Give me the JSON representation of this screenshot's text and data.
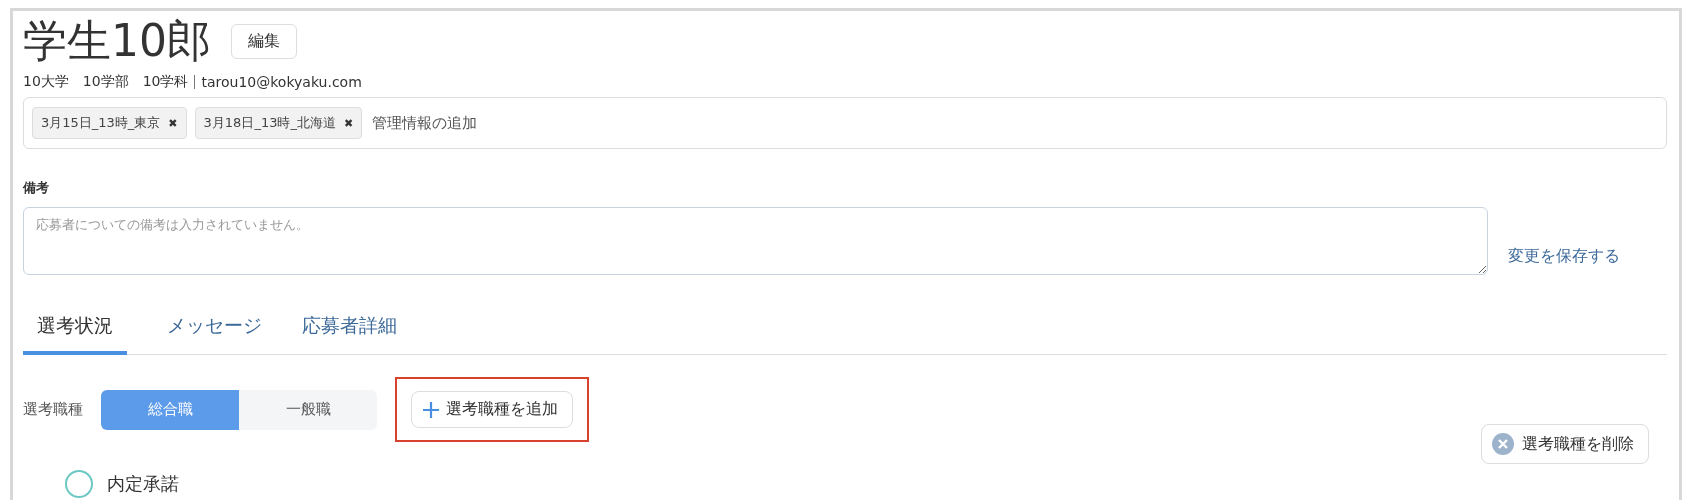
{
  "name": "学生10郎",
  "edit_button": "編集",
  "profile": {
    "university": "10大学",
    "faculty": "10学部",
    "department": "10学科",
    "email": "tarou10@kokyaku.com"
  },
  "tags": [
    {
      "label": "3月15日_13時_東京",
      "remove": "✖"
    },
    {
      "label": "3月18日_13時_北海道",
      "remove": "✖"
    }
  ],
  "tag_input": {
    "placeholder": "管理情報の追加"
  },
  "notes": {
    "label": "備考",
    "placeholder": "応募者についての備考は入力されていません。",
    "save": "変更を保存する"
  },
  "tabs": [
    {
      "label": "選考状況",
      "selected": true
    },
    {
      "label": "メッセージ",
      "selected": false
    },
    {
      "label": "応募者詳細",
      "selected": false
    }
  ],
  "job_types": {
    "label": "選考職種",
    "options": [
      {
        "label": "総合職",
        "selected": true
      },
      {
        "label": "一般職",
        "selected": false
      }
    ],
    "add": {
      "label": "選考職種を追加",
      "highlighted": true
    },
    "delete": "選考職種を削除"
  },
  "stages": [
    {
      "label": "内定承諾"
    }
  ]
}
